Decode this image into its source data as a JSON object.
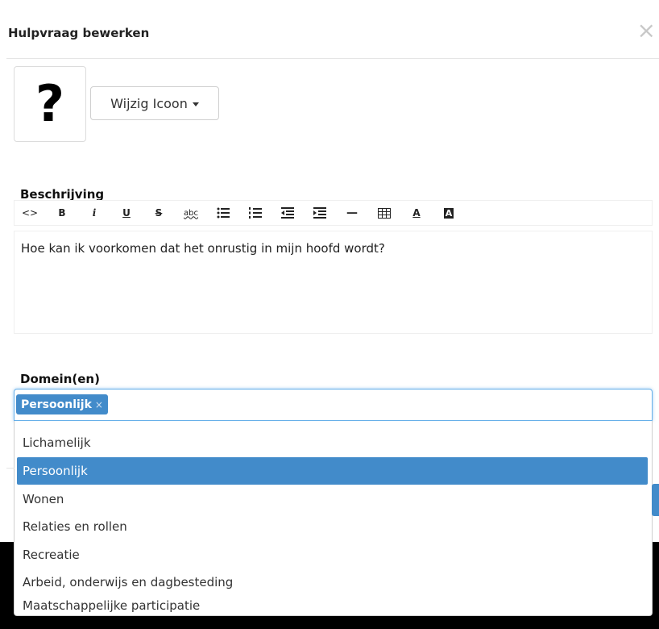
{
  "modal": {
    "title": "Hulpvraag bewerken",
    "close_symbol": "×"
  },
  "icon": {
    "glyph": "?",
    "change_button": "Wijzig Icoon"
  },
  "description": {
    "label": "Beschrijving",
    "toolbar": [
      {
        "name": "code-view-icon",
        "glyph": "<>"
      },
      {
        "name": "bold-icon",
        "glyph": "B"
      },
      {
        "name": "italic-icon",
        "glyph": "i"
      },
      {
        "name": "underline-icon",
        "glyph": "U"
      },
      {
        "name": "strikethrough-icon",
        "glyph": "S"
      },
      {
        "name": "spellcheck-icon",
        "glyph": "abc"
      },
      {
        "name": "bullet-list-icon",
        "glyph": ""
      },
      {
        "name": "numbered-list-icon",
        "glyph": ""
      },
      {
        "name": "outdent-icon",
        "glyph": ""
      },
      {
        "name": "indent-icon",
        "glyph": ""
      },
      {
        "name": "horizontal-rule-icon",
        "glyph": "—"
      },
      {
        "name": "table-icon",
        "glyph": ""
      },
      {
        "name": "text-color-icon",
        "glyph": "A"
      },
      {
        "name": "background-color-icon",
        "glyph": "A"
      }
    ],
    "text": "Hoe kan ik voorkomen dat het onrustig in mijn hoofd wordt?"
  },
  "domains": {
    "label": "Domein(en)",
    "selected_tag": "Persoonlijk",
    "tag_remove": "×",
    "options": [
      "Lichamelijk",
      "Persoonlijk",
      "Wonen",
      "Relaties en rollen",
      "Recreatie",
      "Arbeid, onderwijs en dagbesteding",
      "Maatschappelijke participatie"
    ],
    "highlighted_index": 1
  },
  "colors": {
    "accent": "#428bca",
    "focus_border": "#66afe9"
  }
}
